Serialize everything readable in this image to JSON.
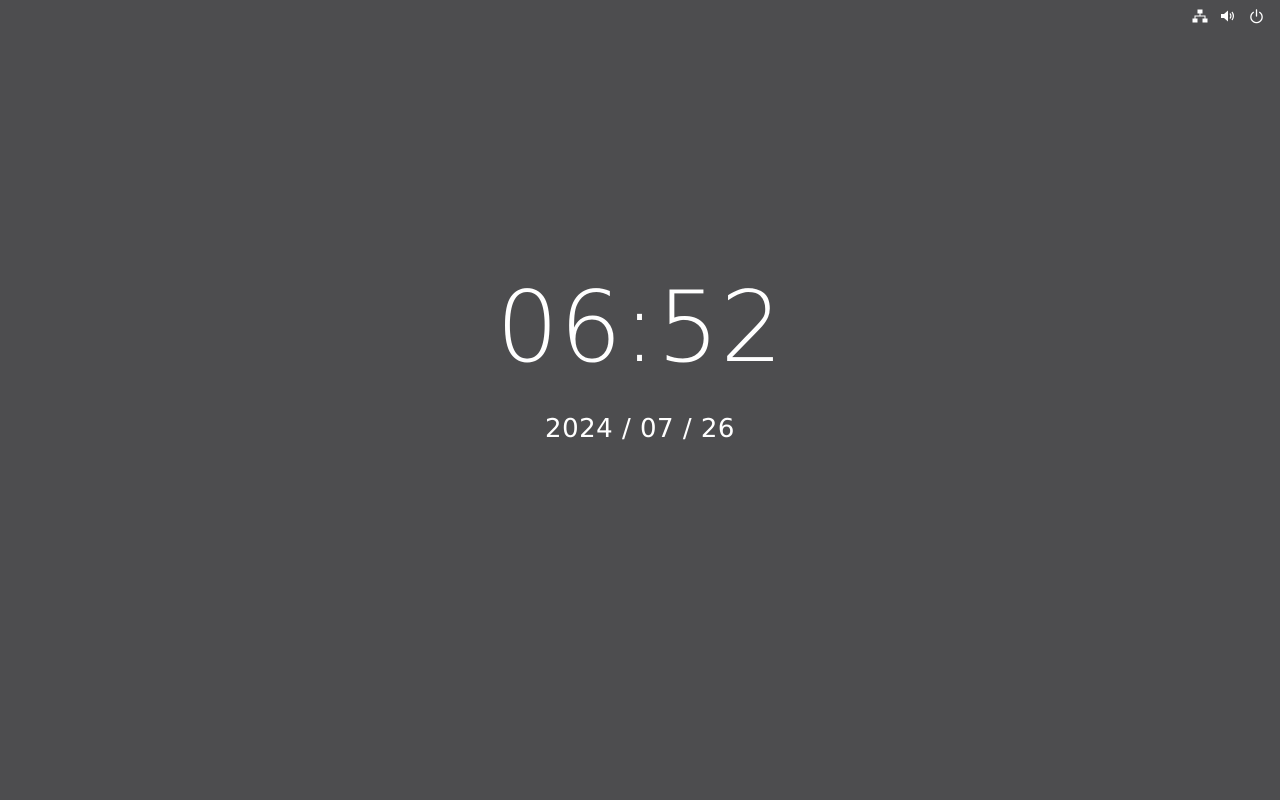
{
  "system_tray": {
    "icons": [
      {
        "name": "network",
        "icon": "network-icon"
      },
      {
        "name": "volume",
        "icon": "volume-icon"
      },
      {
        "name": "power",
        "icon": "power-icon"
      }
    ]
  },
  "lock_screen": {
    "time": "06:52",
    "date": "2024 / 07 / 26"
  },
  "colors": {
    "background": "#4d4d4f",
    "foreground": "#ffffff"
  }
}
